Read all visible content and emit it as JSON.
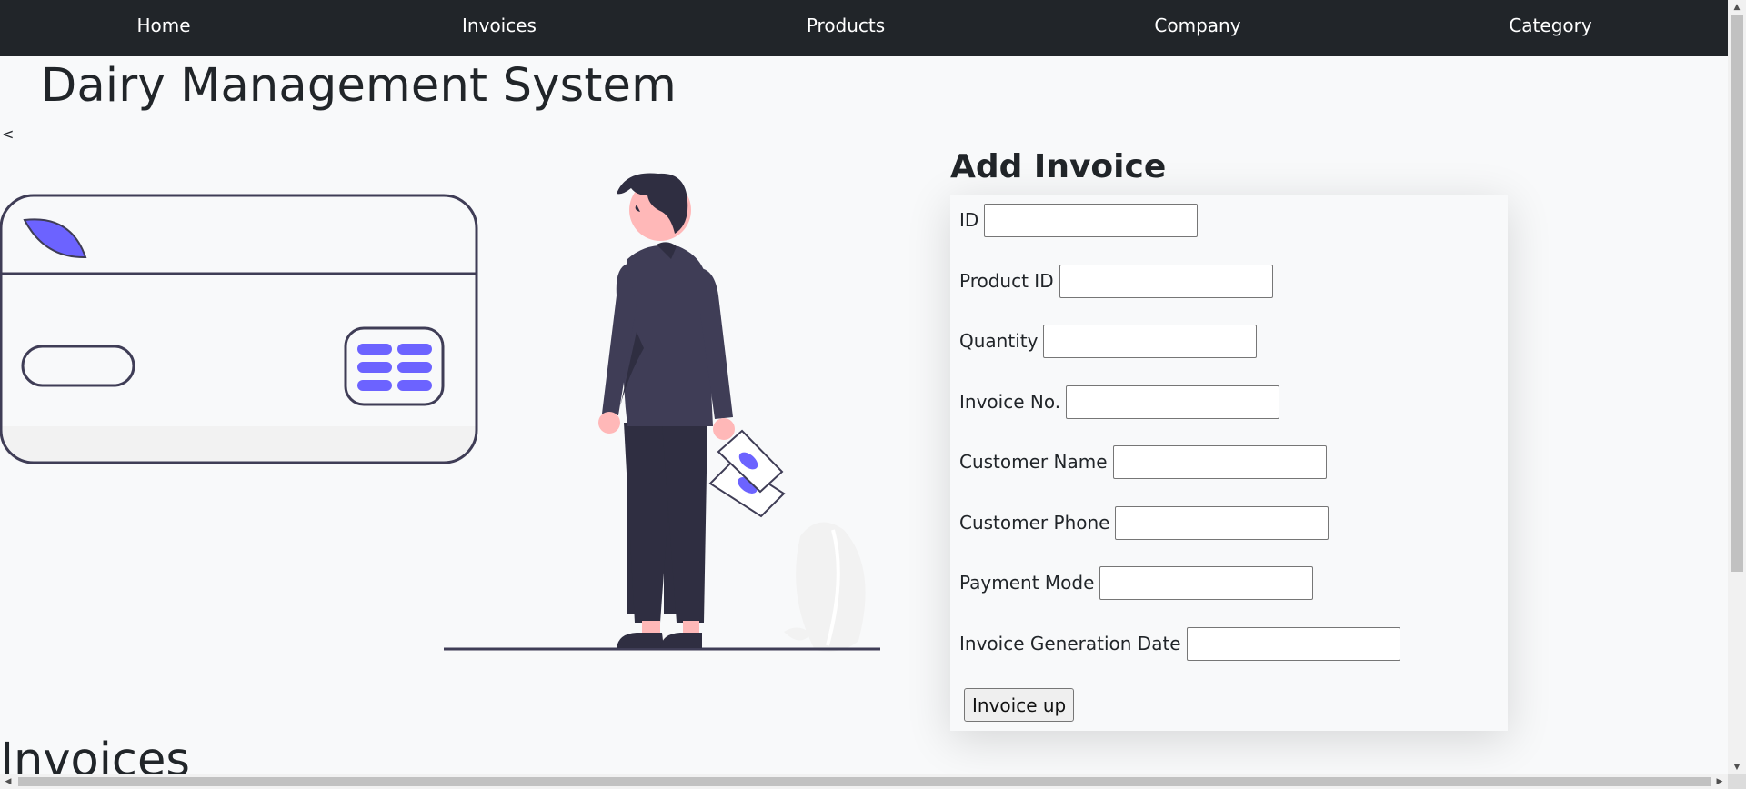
{
  "nav": {
    "items": [
      {
        "label": "Home"
      },
      {
        "label": "Invoices"
      },
      {
        "label": "Products"
      },
      {
        "label": "Company"
      },
      {
        "label": "Category"
      }
    ]
  },
  "page": {
    "title": "Dairy Management System",
    "stray_text": "<",
    "section_heading": "Invoices"
  },
  "form": {
    "title": "Add Invoice",
    "fields": [
      {
        "label": "ID",
        "value": ""
      },
      {
        "label": "Product ID",
        "value": ""
      },
      {
        "label": "Quantity",
        "value": ""
      },
      {
        "label": "Invoice No.",
        "value": ""
      },
      {
        "label": "Customer Name",
        "value": ""
      },
      {
        "label": "Customer Phone",
        "value": ""
      },
      {
        "label": "Payment Mode",
        "value": ""
      },
      {
        "label": "Invoice Generation Date",
        "value": ""
      }
    ],
    "submit_label": "Invoice up"
  },
  "illustration": {
    "icon": "payment-card-person-illustration",
    "colors": {
      "accent": "#6c63ff",
      "outline": "#3f3d56",
      "suit": "#3f3d56",
      "trousers": "#2f2e41",
      "hair": "#2f2e41",
      "skin": "#ffb8b8",
      "plant": "#f2f2f2",
      "card_band": "#f2f2f2"
    }
  },
  "colors": {
    "navbar": "#212529",
    "nav_text": "#ffffff",
    "page_bg": "#f8f9fa",
    "text": "#212529"
  }
}
